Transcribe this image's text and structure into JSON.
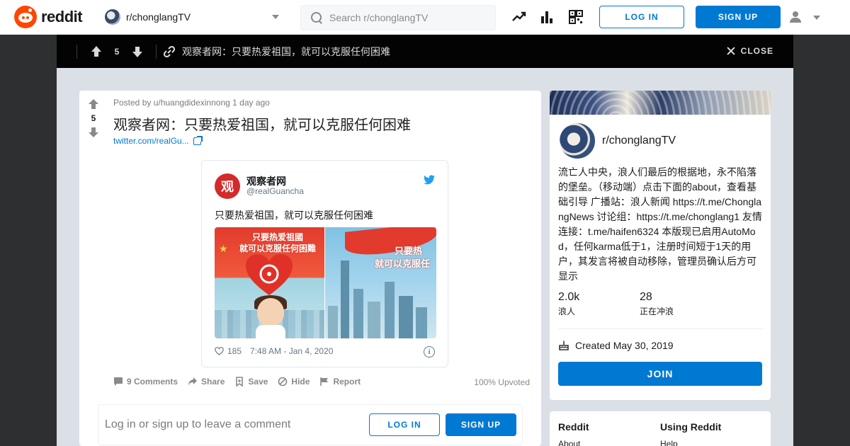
{
  "header": {
    "logo_text": "reddit",
    "community": "r/chonglangTV",
    "search_placeholder": "Search r/chonglangTV",
    "login_label": "LOG IN",
    "signup_label": "SIGN UP"
  },
  "postbar": {
    "score": "5",
    "title": "观察者网：只要热爱祖国，就可以克服任何困难",
    "close_label": "CLOSE"
  },
  "post": {
    "score": "5",
    "posted_by": "Posted by u/huangdidexinnong 1 day ago",
    "title": "观察者网：只要热爱祖国，就可以克服任何困难",
    "link_text": "twitter.com/realGu...",
    "tweet": {
      "avatar_char": "观",
      "name": "观察者网",
      "handle": "@realGuancha",
      "text": "只要热爱祖国，就可以克服任何困难",
      "media_left_text_line1": "只要热爱祖國",
      "media_left_text_line2": "就可以克服任何困難",
      "media_right_text_line1": "只要热",
      "media_right_text_line2": "就可以克服任",
      "likes": "185",
      "timestamp": "7:48 AM - Jan 4, 2020"
    },
    "actions": {
      "comments": "9 Comments",
      "share": "Share",
      "save": "Save",
      "hide": "Hide",
      "report": "Report"
    },
    "upvoted": "100% Upvoted",
    "comment_prompt": "Log in or sign up to leave a comment",
    "comment_login": "LOG IN",
    "comment_signup": "SIGN UP"
  },
  "sidebar": {
    "name": "r/chonglangTV",
    "description": "流亡⼈中央，浪人们最后的根据地，永不陷落的堡垒。（移动端）点击下面的about，查看基础引导 广播站：浪人新闻 https://t.me/ChonglangNews 讨论组：https://t.me/chonglang1 友情连接：t.me/haifen6324 本版现已启用AutoMod，任何karma低于1，注册时间短于1天的用户，其发言将被自动移除，管理员确认后方可显示",
    "members": "2.0k",
    "members_label": "浪人",
    "online": "28",
    "online_label": "正在冲浪",
    "created": "Created May 30, 2019",
    "join_label": "JOIN"
  },
  "footer": {
    "col1_head": "Reddit",
    "col1_link": "About",
    "col2_head": "Using Reddit",
    "col2_link": "Help"
  },
  "colors": {
    "brand": "#ff4500",
    "accent": "#0079d3",
    "overlay_bar": "#030303"
  }
}
